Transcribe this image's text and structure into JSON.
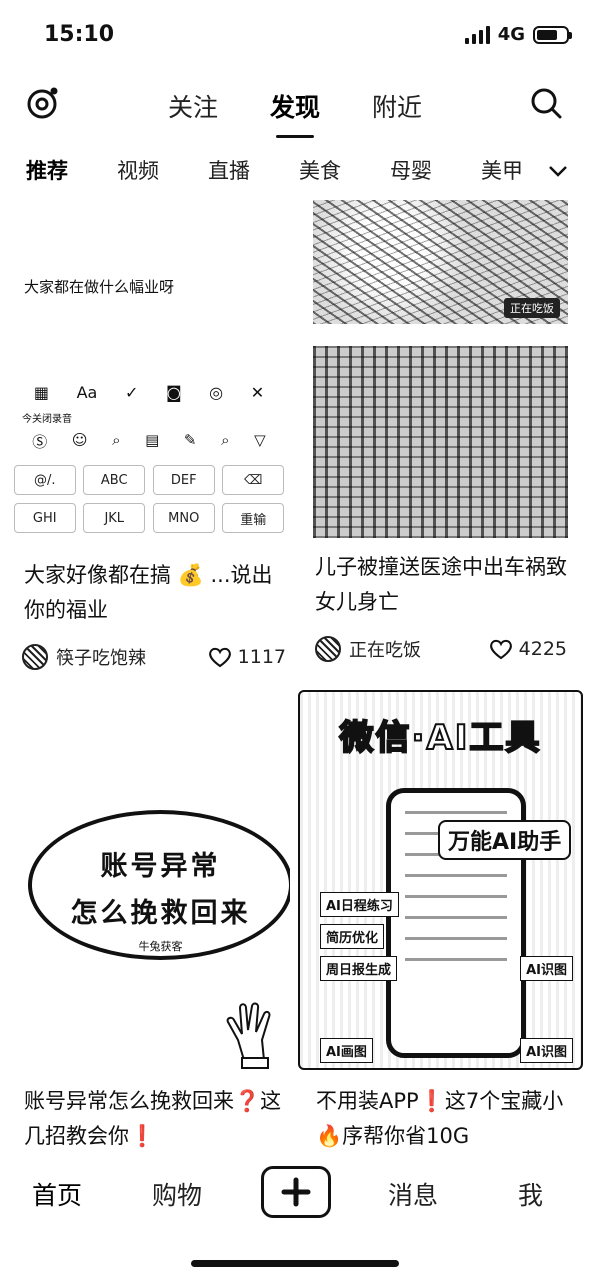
{
  "status": {
    "time": "15:10",
    "network": "4G",
    "battery_level_pct": 70
  },
  "nav": {
    "tabs": [
      {
        "label": "关注",
        "active": false
      },
      {
        "label": "发现",
        "active": true
      },
      {
        "label": "附近",
        "active": false
      }
    ],
    "left_icon": "camera-ring-icon",
    "right_icon": "search-icon"
  },
  "categories": [
    "推荐",
    "视频",
    "直播",
    "美食",
    "母婴",
    "美甲"
  ],
  "feed": {
    "card1": {
      "image_caption": "大家都在做什么幅业呀",
      "keyboard": {
        "toolbar_hint": "今关闭录音",
        "row1": [
          "@/.",
          "ABC",
          "DEF",
          "⌫"
        ],
        "row2": [
          "GHI",
          "JKL",
          "MNO",
          "重输"
        ]
      },
      "title": "大家好像都在搞 💰 ...说出你的福业",
      "author": "筷子吃饱辣",
      "likes": "1117"
    },
    "card2": {
      "corner_tag": "正在吃饭",
      "title": "儿子被撞送医途中出车祸致女儿身亡",
      "author": "正在吃饭",
      "likes": "4225"
    },
    "card3": {
      "bubble_line1": "账号异常",
      "bubble_line2": "怎么挽救回来",
      "bubble_sub": "牛兔获客",
      "title": "账号异常怎么挽救回来❓这几招教会你❗"
    },
    "card4": {
      "poster_title": "微信·AI工具",
      "poster_badge": "万能AI助手",
      "poster_labels": [
        "AI日程练习",
        "简历优化",
        "周日报生成",
        "AI识图",
        "AI画图",
        "AI识图"
      ],
      "title": "不用装APP❗这7个宝藏小🔥序帮你省10G"
    }
  },
  "bottom_nav": {
    "items": [
      {
        "label": "首页",
        "active": true
      },
      {
        "label": "购物",
        "active": false
      },
      {
        "label": "消息",
        "active": false
      },
      {
        "label": "我",
        "active": false
      }
    ]
  }
}
